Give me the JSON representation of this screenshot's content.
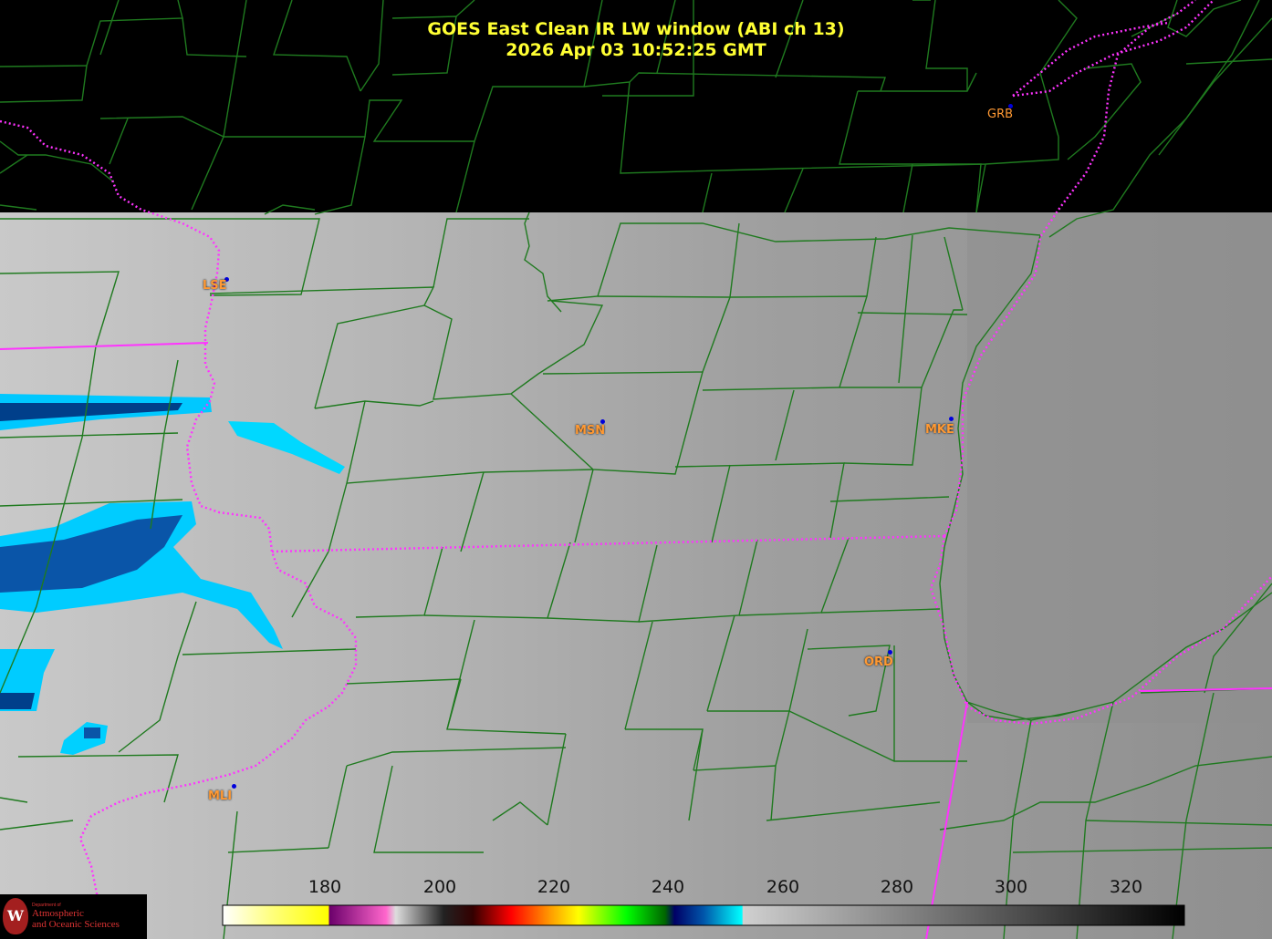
{
  "title": {
    "line1": "GOES East Clean IR LW window (ABI ch 13)",
    "line2": "2026 Apr 03  10:52:25 GMT"
  },
  "cities": [
    {
      "code": "GRB"
    },
    {
      "code": "LSE"
    },
    {
      "code": "MSN"
    },
    {
      "code": "MKE"
    },
    {
      "code": "ORD"
    },
    {
      "code": "MLI"
    }
  ],
  "colorbar": {
    "ticks": [
      "180",
      "200",
      "220",
      "240",
      "260",
      "280",
      "300",
      "320"
    ]
  },
  "logo": {
    "dept": "Department of",
    "line1": "Atmospheric",
    "line2": "and Oceanic Sciences",
    "seal": "W"
  },
  "colors": {
    "title": "#ffff33",
    "county_lines": "#1f7a1f",
    "state_lines": "#ff33ff",
    "city_label": "#ff9933",
    "city_dot": "#0000dd"
  }
}
